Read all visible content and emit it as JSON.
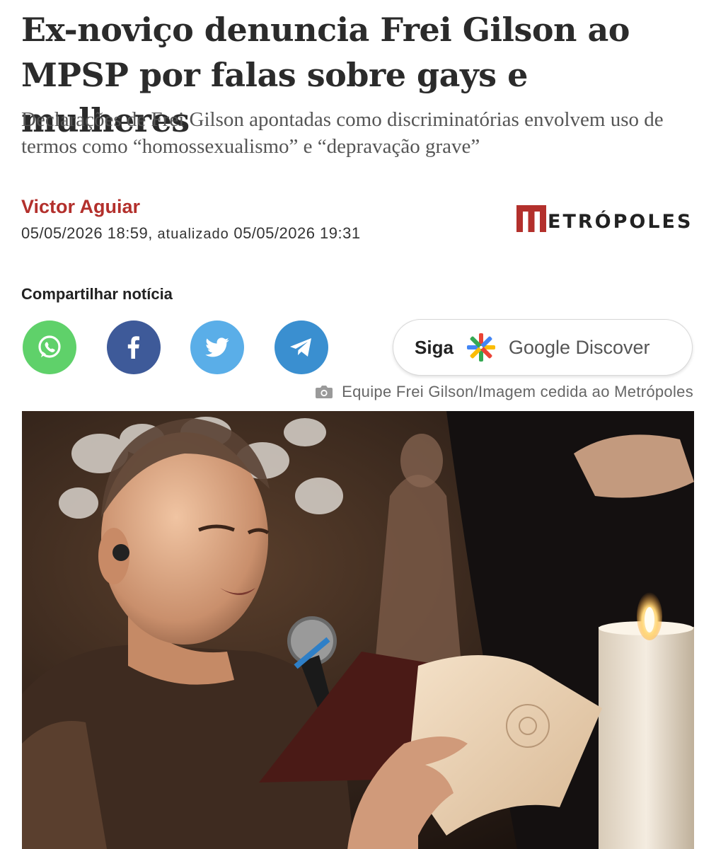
{
  "article": {
    "headline": "Ex-noviço denuncia Frei Gilson ao MPSP por falas sobre gays e mulheres",
    "subtitle": "Declarações de Frei Gilson apontadas como discriminatórias envolvem uso de termos como “homossexualismo” e “depravação grave”",
    "author": "Victor Aguiar",
    "published": "05/05/2026 18:59,",
    "updated_label": "atualizado",
    "updated": "05/05/2026 19:31"
  },
  "brand": {
    "logo_text": "ETRÓPOLES",
    "logo_initial": "M",
    "accent": "#b3302c"
  },
  "share": {
    "title": "Compartilhar notícia",
    "buttons": [
      {
        "name": "whatsapp",
        "icon": "whatsapp-icon",
        "color": "#5fd16a"
      },
      {
        "name": "facebook",
        "icon": "facebook-icon",
        "color": "#3e5a99"
      },
      {
        "name": "twitter",
        "icon": "twitter-icon",
        "color": "#5aaee8"
      },
      {
        "name": "telegram",
        "icon": "telegram-icon",
        "color": "#3a8fd0"
      }
    ]
  },
  "discover": {
    "follow": "Siga",
    "label": "Google Discover"
  },
  "photo": {
    "credit": "Equipe Frei Gilson/Imagem cedida ao Metrópoles"
  }
}
